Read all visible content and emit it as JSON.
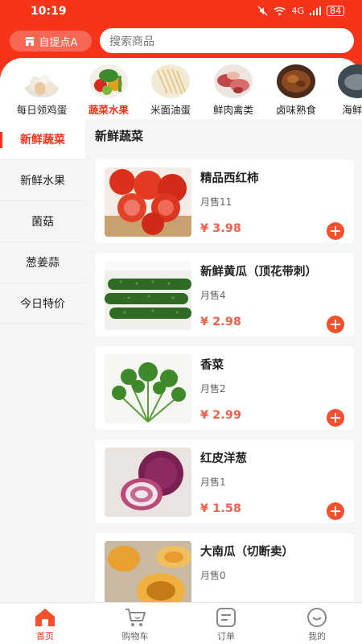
{
  "status_bar": {
    "time": "10:19",
    "signal_text": "4G",
    "battery": "84"
  },
  "header": {
    "pickup_label": "自提点A",
    "search_placeholder": "搜索商品"
  },
  "categories": [
    {
      "label": "每日领鸡蛋",
      "icon": "eggs-image"
    },
    {
      "label": "蔬菜水果",
      "icon": "vegetables-image",
      "active": true
    },
    {
      "label": "米面油蛋",
      "icon": "noodles-image"
    },
    {
      "label": "鲜肉禽类",
      "icon": "meat-image"
    },
    {
      "label": "卤味熟食",
      "icon": "braised-image"
    },
    {
      "label": "海鲜水",
      "icon": "seafood-image"
    }
  ],
  "sidebar": {
    "items": [
      {
        "label": "新鲜蔬菜",
        "active": true
      },
      {
        "label": "新鲜水果"
      },
      {
        "label": "菌菇"
      },
      {
        "label": "葱姜蒜"
      },
      {
        "label": "今日特价"
      }
    ]
  },
  "section": {
    "title": "新鲜蔬菜"
  },
  "products": [
    {
      "name": "精品西红柿",
      "sold": "月售11",
      "price": "¥ 3.98",
      "image": "tomato-image"
    },
    {
      "name": "新鲜黄瓜（顶花带刺）",
      "sold": "月售4",
      "price": "¥ 2.98",
      "image": "cucumber-image"
    },
    {
      "name": "香菜",
      "sold": "月售2",
      "price": "¥ 2.99",
      "image": "coriander-image"
    },
    {
      "name": "红皮洋葱",
      "sold": "月售1",
      "price": "¥ 1.58",
      "image": "onion-image"
    },
    {
      "name": "大南瓜（切断卖）",
      "sold": "月售0",
      "price": "",
      "image": "pumpkin-image"
    }
  ],
  "tabbar": {
    "tabs": [
      {
        "label": "首页",
        "icon": "home-icon",
        "active": true
      },
      {
        "label": "购物车",
        "icon": "cart-icon"
      },
      {
        "label": "订单",
        "icon": "order-icon"
      },
      {
        "label": "我的",
        "icon": "profile-icon"
      }
    ]
  },
  "colors": {
    "brand": "#f5341a",
    "price": "#f2604a",
    "add_button": "#f5512e"
  }
}
